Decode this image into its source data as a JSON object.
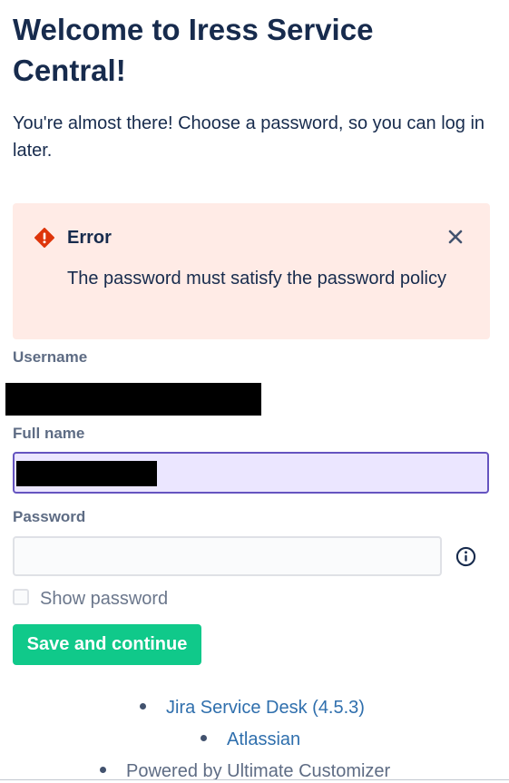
{
  "page": {
    "title": "Welcome to Iress Service Central!",
    "intro": "You're almost there! Choose a password, so you can log in later."
  },
  "error": {
    "title": "Error",
    "message": "The password must satisfy the password policy",
    "icon": "error-icon",
    "close_icon": "close-icon"
  },
  "form": {
    "username_label": "Username",
    "username_value": "",
    "fullname_label": "Full name",
    "fullname_value": "",
    "password_label": "Password",
    "password_value": "",
    "password_info_icon": "info-icon",
    "show_password_label": "Show password",
    "show_password_checked": false,
    "submit_label": "Save and continue"
  },
  "footer": {
    "items": [
      {
        "label": "Jira Service Desk (4.5.3)",
        "link": true
      },
      {
        "label": "Atlassian",
        "link": true
      },
      {
        "label": "Powered by Ultimate Customizer",
        "link": false
      }
    ]
  },
  "colors": {
    "heading": "#172b4d",
    "error_bg": "#ffebe6",
    "error_icon": "#de350b",
    "focus_border": "#6554c0",
    "focus_bg": "#ebe6ff",
    "primary_button": "#10c98a",
    "link": "#2f6fad"
  }
}
